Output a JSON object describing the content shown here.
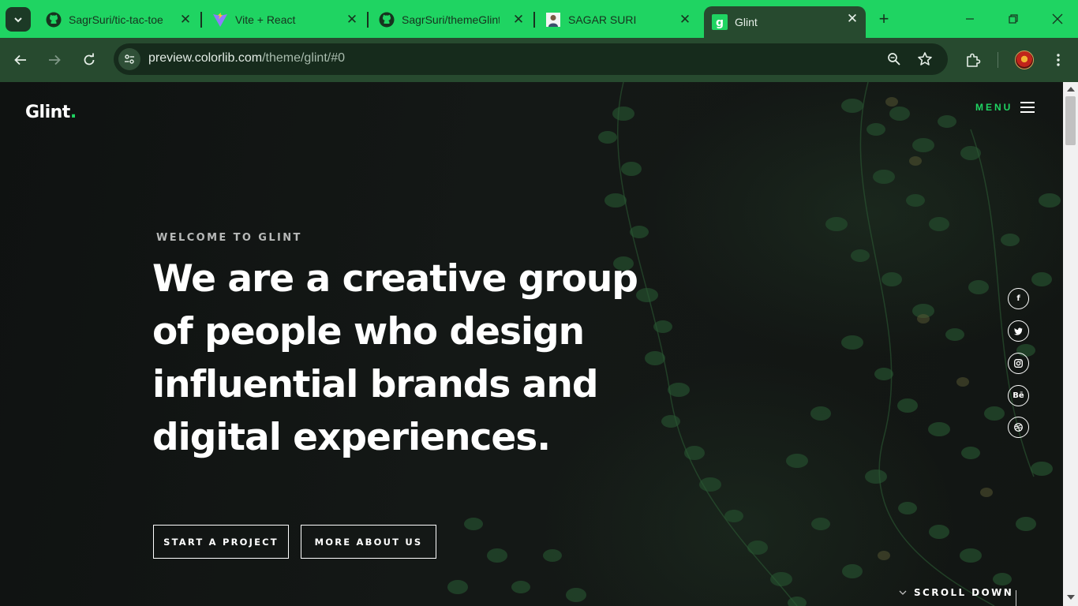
{
  "browser": {
    "tabs": [
      {
        "label": "SagrSuri/tic-tac-toe",
        "icon": "github-icon"
      },
      {
        "label": "Vite + React",
        "icon": "vite-icon"
      },
      {
        "label": "SagrSuri/themeGlint",
        "icon": "github-icon"
      },
      {
        "label": "SAGAR SURI",
        "icon": "profile-photo-icon"
      },
      {
        "label": "Glint",
        "icon": "glint-favicon"
      }
    ],
    "active_tab_index": 4,
    "url_host": "preview.colorlib.com",
    "url_path": "/theme/glint/#0",
    "accent": "#1fd462",
    "toolbar_color": "#274a2f"
  },
  "site": {
    "logo": "Glint",
    "logo_dot": ".",
    "menu_label": "MENU",
    "eyebrow": "WELCOME TO GLINT",
    "headline": "We are a creative group of people who design influential brands and digital experiences.",
    "buttons": {
      "start": "START A PROJECT",
      "about": "MORE ABOUT US"
    },
    "social": [
      {
        "name": "facebook",
        "glyph": "f"
      },
      {
        "name": "twitter",
        "glyph": "t"
      },
      {
        "name": "instagram",
        "glyph": ""
      },
      {
        "name": "behance",
        "glyph": "Bē"
      },
      {
        "name": "dribbble",
        "glyph": ""
      }
    ],
    "scroll_down": "SCROLL DOWN"
  }
}
